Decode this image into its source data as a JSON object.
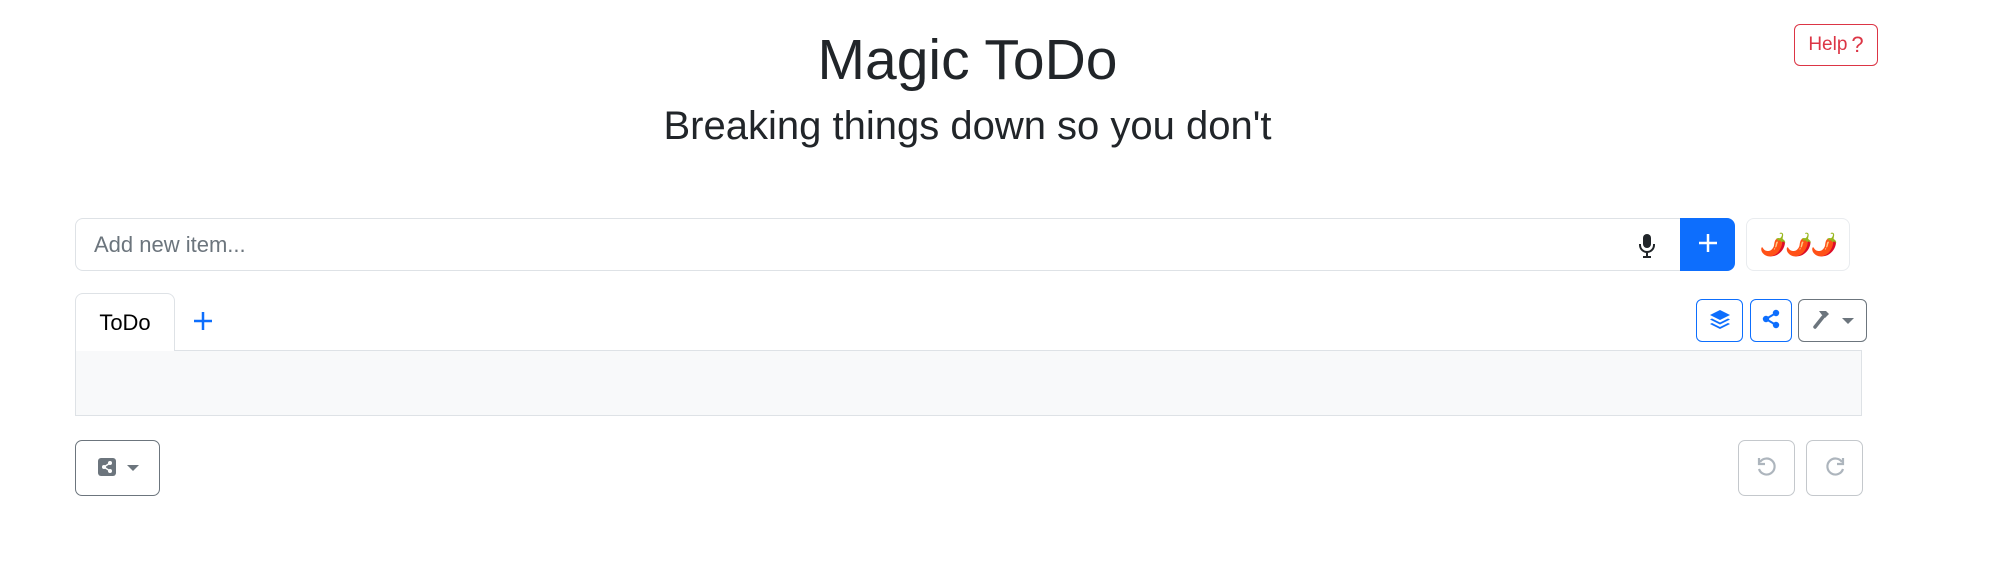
{
  "header": {
    "title": "Magic ToDo",
    "subtitle": "Breaking things down so you don't",
    "help_label": "Help",
    "help_icon": "?"
  },
  "add_item": {
    "placeholder": "Add new item...",
    "mic_icon": "microphone-icon",
    "add_icon": "plus-icon"
  },
  "spiciness": {
    "label": "🌶️🌶️🌶️",
    "level": 3
  },
  "tabs": [
    {
      "label": "ToDo",
      "active": true
    }
  ],
  "tab_add_icon": "plus-icon",
  "toolbar": {
    "icons": [
      "layers-icon",
      "share-nodes-icon",
      "hammer-icon"
    ]
  },
  "bottom": {
    "export_icon": "share-square-icon",
    "undo_icon": "undo-icon",
    "redo_icon": "redo-icon"
  },
  "colors": {
    "primary": "#0d6efd",
    "danger": "#dc3545",
    "secondary": "#6c757d",
    "panel_bg": "#f8f9fa"
  }
}
